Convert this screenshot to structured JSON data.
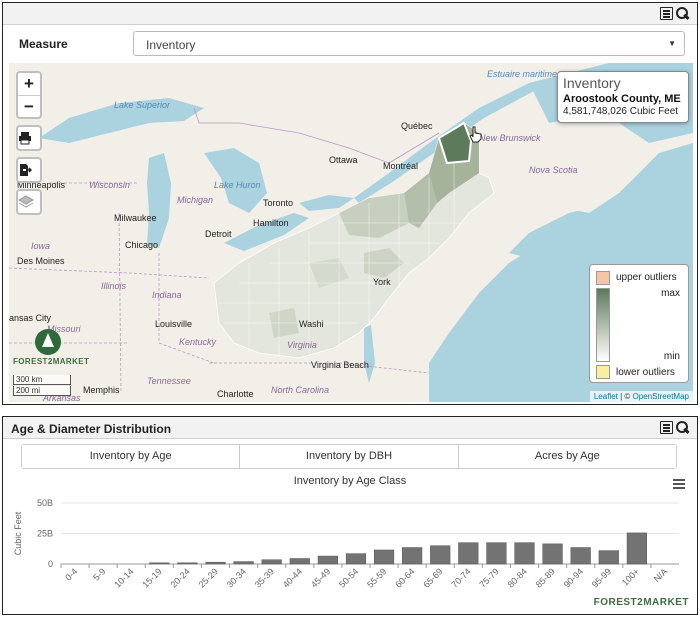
{
  "map_panel": {
    "measure_label": "Measure",
    "measure_value": "Inventory",
    "zoom_in": "+",
    "zoom_out": "−",
    "tooltip": {
      "title": "Inventory",
      "county": "Aroostook County, ME",
      "value": "4,581,748,026 Cubic Feet"
    },
    "legend": {
      "upper": "upper outliers",
      "max": "max",
      "min": "min",
      "lower": "lower outliers",
      "colors": {
        "upper": "#f6c4a6",
        "max": "#5d7a5a",
        "min": "#ffffff",
        "lower": "#fbeea0"
      }
    },
    "logo_text": "FOREST2MARKET",
    "scale": {
      "km": "300 km",
      "mi": "200 mi"
    },
    "attribution": {
      "leaflet": "Leaflet",
      "sep": " | © ",
      "osm": "OpenStreetMap"
    },
    "labels": {
      "lake_superior": "Lake Superior",
      "quebec": "Québec",
      "new_brunswick": "New Brunswick",
      "ottawa": "Ottawa",
      "montreal": "Montréal",
      "nova_scotia": "Nova Scotia",
      "minneapolis": "Minneapolis",
      "wisconsin": "Wisconsin",
      "lake_huron": "Lake Huron",
      "michigan": "Michigan",
      "milwaukee": "Milwaukee",
      "toronto": "Toronto",
      "hamilton": "Hamilton",
      "detroit": "Detroit",
      "chicago": "Chicago",
      "iowa": "Iowa",
      "des_moines": "Des Moines",
      "illinois": "Illinois",
      "indiana": "Indiana",
      "kansas_city": "ansas City",
      "missouri": "Missouri",
      "louisville": "Louisville",
      "kentucky": "Kentucky",
      "virginia": "Virginia",
      "washington": "Washi",
      "york": "York",
      "tennessee": "Tennessee",
      "memphis": "Memphis",
      "charlotte": "Charlotte",
      "north_carolina": "North Carolina",
      "virginia_beach": "Virginia Beach",
      "estuaire": "Estuaire maritime",
      "arkansas": "Arkansas"
    }
  },
  "chart_panel": {
    "header_title": "Age & Diameter Distribution",
    "tabs": [
      "Inventory by Age",
      "Inventory by DBH",
      "Acres by Age"
    ],
    "footer_logo": "FOREST2MARKET"
  },
  "chart_data": {
    "type": "bar",
    "title": "Inventory by Age Class",
    "ylabel": "Cubic Feet",
    "xlabel": "",
    "ylim": [
      0,
      50
    ],
    "y_ticks": [
      "0",
      "25B",
      "50B"
    ],
    "y_tick_values": [
      0,
      25,
      50
    ],
    "y_unit": "billion cubic feet",
    "bar_color": "#737373",
    "categories": [
      "0-4",
      "5-9",
      "10-14",
      "15-19",
      "20-24",
      "25-29",
      "30-34",
      "35-39",
      "40-44",
      "45-49",
      "50-54",
      "55-59",
      "60-64",
      "65-69",
      "70-74",
      "75-79",
      "80-84",
      "85-89",
      "90-94",
      "95-99",
      "100+",
      "N/A"
    ],
    "values": [
      0,
      0,
      0,
      1,
      1,
      1.5,
      2,
      3.5,
      4.5,
      6.5,
      8.5,
      11.5,
      13.5,
      15,
      17.5,
      17.5,
      17.5,
      16.5,
      13.5,
      11,
      25.5,
      0
    ]
  }
}
